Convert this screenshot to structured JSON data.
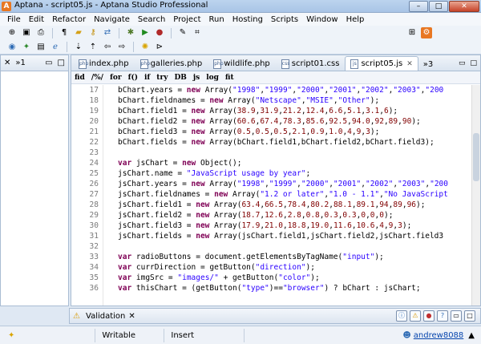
{
  "window": {
    "title": "Aptana - script05.js - Aptana Studio Professional"
  },
  "menu": [
    "File",
    "Edit",
    "Refactor",
    "Navigate",
    "Search",
    "Project",
    "Run",
    "Hosting",
    "Scripts",
    "Window",
    "Help"
  ],
  "left_panel": {
    "tab_label": "»1"
  },
  "tabs": [
    {
      "label": "index.php",
      "active": false
    },
    {
      "label": "galleries.php",
      "active": false
    },
    {
      "label": "wildlife.php",
      "active": false
    },
    {
      "label": "script01.css",
      "active": false
    },
    {
      "label": "script05.js",
      "active": true
    }
  ],
  "tab_overflow": "»3",
  "snippets": [
    "fid",
    "/%/",
    "for",
    "f()",
    "if",
    "try",
    "DB",
    "js",
    "log",
    "fit"
  ],
  "code_lines": [
    {
      "n": "17",
      "text": "bChart.years = new Array(\"1998\",\"1999\",\"2000\",\"2001\",\"2002\",\"2003\",\"200"
    },
    {
      "n": "18",
      "text": "bChart.fieldnames = new Array(\"Netscape\",\"MSIE\",\"Other\");"
    },
    {
      "n": "19",
      "text": "bChart.field1 = new Array(38.9,31.9,21.2,12.4,6.6,5.1,3.1,6);"
    },
    {
      "n": "20",
      "text": "bChart.field2 = new Array(60.6,67.4,78.3,85.6,92.5,94.0,92,89,90);"
    },
    {
      "n": "21",
      "text": "bChart.field3 = new Array(0.5,0.5,0.5,2.1,0.9,1.0,4,9,3);"
    },
    {
      "n": "22",
      "text": "bChart.fields = new Array(bChart.field1,bChart.field2,bChart.field3);"
    },
    {
      "n": "23",
      "text": ""
    },
    {
      "n": "24",
      "text": "var jsChart = new Object();"
    },
    {
      "n": "25",
      "text": "jsChart.name = \"JavaScript usage by year\";"
    },
    {
      "n": "26",
      "text": "jsChart.years = new Array(\"1998\",\"1999\",\"2000\",\"2001\",\"2002\",\"2003\",\"200"
    },
    {
      "n": "27",
      "text": "jsChart.fieldnames = new Array(\"1.2 or later\",\"1.0 - 1.1\",\"No JavaScript"
    },
    {
      "n": "28",
      "text": "jsChart.field1 = new Array(63.4,66.5,78.4,80.2,88.1,89.1,94,89,96);"
    },
    {
      "n": "29",
      "text": "jsChart.field2 = new Array(18.7,12.6,2.8,0.8,0.3,0.3,0,0,0);"
    },
    {
      "n": "30",
      "text": "jsChart.field3 = new Array(17.9,21.0,18.8,19.0,11.6,10.6,4,9,3);"
    },
    {
      "n": "31",
      "text": "jsChart.fields = new Array(jsChart.field1,jsChart.field2,jsChart.field3"
    },
    {
      "n": "32",
      "text": ""
    },
    {
      "n": "33",
      "text": "var radioButtons = document.getElementsByTagName(\"input\");"
    },
    {
      "n": "34",
      "text": "var currDirection = getButton(\"direction\");"
    },
    {
      "n": "35",
      "text": "var imgSrc = \"images/\" + getButton(\"color\");"
    },
    {
      "n": "36",
      "text": "var thisChart = (getButton(\"type\")==\"browser\") ? bChart : jsChart;"
    }
  ],
  "validation": {
    "label": "Validation"
  },
  "status": {
    "writable": "Writable",
    "insert": "Insert",
    "user": "andrew8088"
  },
  "colors": {
    "keyword": "#7f0055",
    "string": "#2a00ff",
    "number": "#800000"
  }
}
